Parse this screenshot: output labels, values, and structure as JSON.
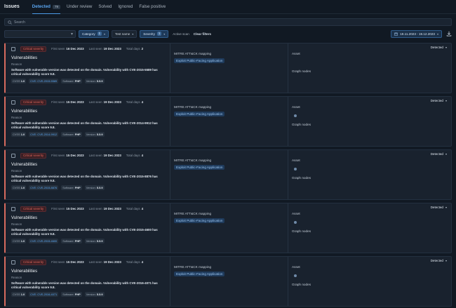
{
  "header": {
    "title": "Issues",
    "tabs": [
      {
        "label": "Detected",
        "count": "79"
      },
      {
        "label": "Under review"
      },
      {
        "label": "Solved"
      },
      {
        "label": "Ignored"
      },
      {
        "label": "False positive"
      }
    ]
  },
  "search": {
    "placeholder": "Search"
  },
  "filters": {
    "category": {
      "label": "Category",
      "count": "1"
    },
    "test_name": {
      "label": "Test name"
    },
    "severity": {
      "label": "Severity",
      "count": "1"
    },
    "active_scan": "Active scan",
    "clear": "Clear filters",
    "date_range": "19.11.2023 - 19.12.2023"
  },
  "labels": {
    "first_seen": "First seen",
    "last_seen": "Last seen",
    "total_days": "Total days",
    "reason": "Reason",
    "mitre": "MITRE ATT&CK mapping",
    "asset": "Asset",
    "graph_nodes": "Graph nodes",
    "cvss": "CVSS",
    "cve": "CVE",
    "software": "Software",
    "version": "Version"
  },
  "issues": [
    {
      "severity": "Critical severity",
      "first_seen": "16 Dec 2023",
      "last_seen": "19 Dec 2023",
      "total_days": "2",
      "title": "Vulnerabilities",
      "description": "Software with vulnerable version was detected on the domain. Vulnerability with CVE-2015-5589 has critical vulnerability score 9.8.",
      "cvss": "1.0",
      "cve": "CVE-2015-5589",
      "software": "PHP",
      "version": "5.5.9",
      "mitre": "Exploit Public-Facing Application",
      "status": "Detected",
      "asset_dot": false
    },
    {
      "severity": "Critical severity",
      "first_seen": "15 Dec 2023",
      "last_seen": "19 Dec 2023",
      "total_days": "4",
      "title": "Vulnerabilities",
      "description": "Software with vulnerable version was detected on the domain. Vulnerability with CVE-2014-9912 has critical vulnerability score 9.8.",
      "cvss": "1.0",
      "cve": "CVE-2014-9912",
      "software": "PHP",
      "version": "5.5.9",
      "mitre": "Exploit Public-Facing Application",
      "status": "Detected",
      "asset_dot": true
    },
    {
      "severity": "Critical severity",
      "first_seen": "15 Dec 2023",
      "last_seen": "19 Dec 2023",
      "total_days": "4",
      "title": "Vulnerabilities",
      "description": "Software with vulnerable version was detected on the domain. Vulnerability with CVE-2015-8876 has critical vulnerability score 9.8.",
      "cvss": "1.0",
      "cve": "CVE-2015-8876",
      "software": "PHP",
      "version": "5.5.9",
      "mitre": "Exploit Public-Facing Application",
      "status": "Detected",
      "asset_dot": true
    },
    {
      "severity": "Critical severity",
      "first_seen": "15 Dec 2023",
      "last_seen": "19 Dec 2023",
      "total_days": "4",
      "title": "Vulnerabilities",
      "description": "Software with vulnerable version was detected on the domain. Vulnerability with CVE-2015-4600 has critical vulnerability score 9.8.",
      "cvss": "1.0",
      "cve": "CVE-2015-4600",
      "software": "PHP",
      "version": "5.5.9",
      "mitre": "Exploit Public-Facing Application",
      "status": "Detected",
      "asset_dot": true
    },
    {
      "severity": "Critical severity",
      "first_seen": "15 Dec 2023",
      "last_seen": "19 Dec 2023",
      "total_days": "4",
      "title": "Vulnerabilities",
      "description": "Software with vulnerable version was detected on the domain. Vulnerability with CVE-2016-4071 has critical vulnerability score 9.8.",
      "cvss": "1.0",
      "cve": "CVE-2016-4071",
      "software": "PHP",
      "version": "5.5.9",
      "mitre": "Exploit Public-Facing Application",
      "status": "Detected",
      "asset_dot": true
    }
  ],
  "icons": {
    "search": "search-icon",
    "calendar": "calendar-icon",
    "download": "download-icon",
    "chevron": "chevron-down-icon"
  },
  "colors": {
    "accent": "#4c9be8",
    "critical": "#e0645a",
    "background": "#111923"
  }
}
